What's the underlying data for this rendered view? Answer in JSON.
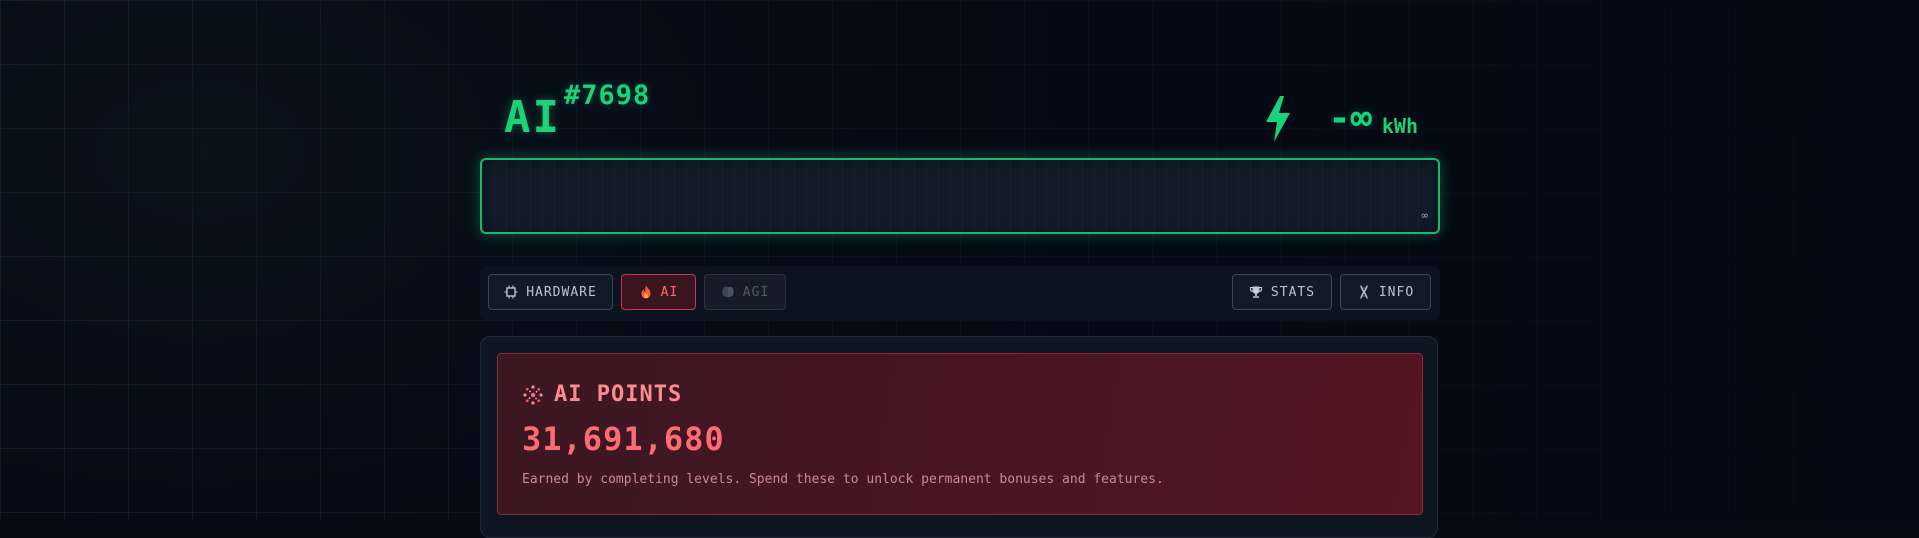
{
  "header": {
    "title": "AI",
    "id": "#7698",
    "energy_value": "-∞",
    "energy_unit": "kWh"
  },
  "progress": {
    "label": "∞",
    "fill": 0
  },
  "tabs": {
    "hardware": {
      "label": "HARDWARE",
      "icon": "cpu-icon"
    },
    "ai": {
      "label": "AI",
      "icon": "flame-icon",
      "active": true
    },
    "agi": {
      "label": "AGI",
      "icon": "brain-icon",
      "disabled": true
    },
    "stats": {
      "label": "STATS",
      "icon": "trophy-icon"
    },
    "info": {
      "label": "INFO",
      "icon": "dna-icon"
    }
  },
  "points_card": {
    "title": "AI POINTS",
    "icon": "sparkle-icon",
    "value": "31,691,680",
    "description": "Earned by completing levels. Spend these to unlock permanent bonuses and features."
  },
  "colors": {
    "accent_green": "#19d27a",
    "accent_red": "#ff6b74",
    "background": "#060b16"
  }
}
